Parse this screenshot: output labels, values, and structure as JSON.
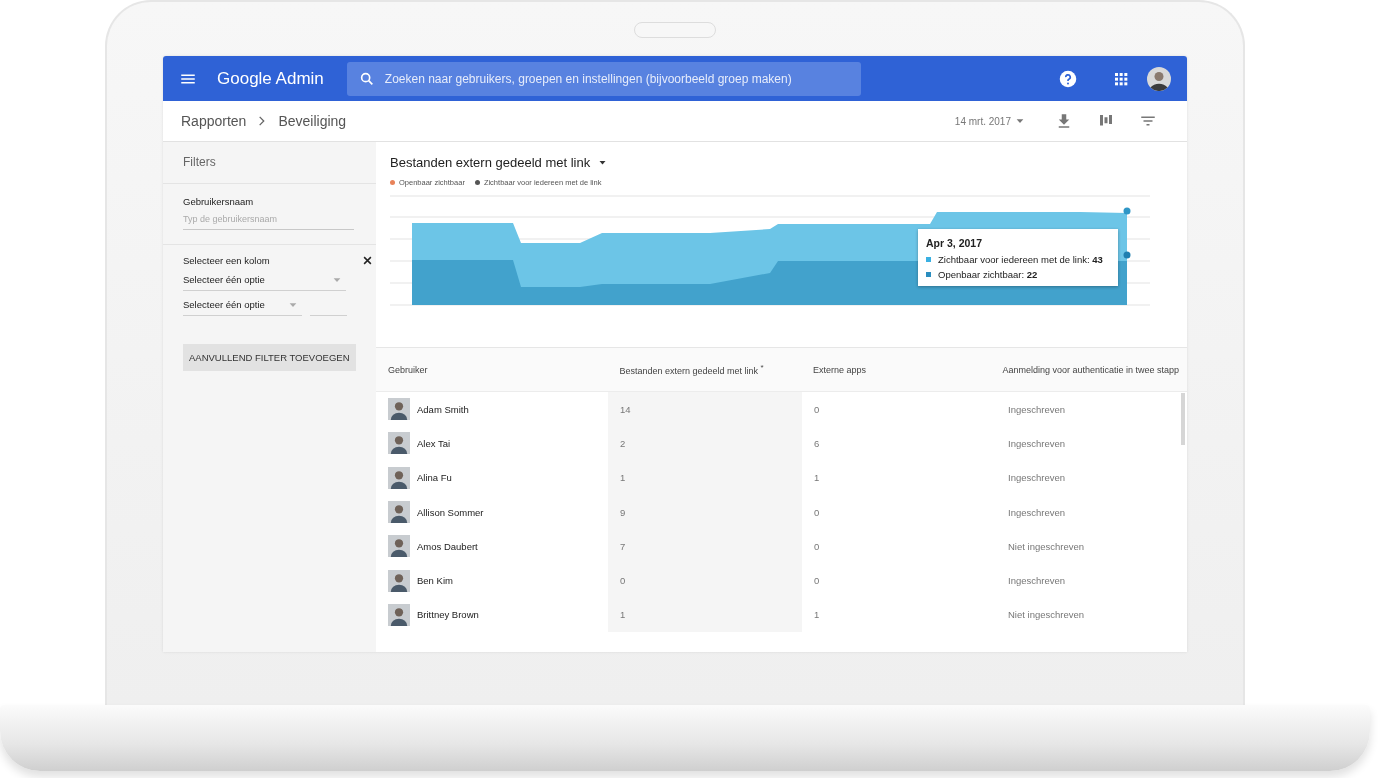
{
  "app": {
    "title": "Google Admin"
  },
  "search": {
    "placeholder": "Zoeken naar gebruikers, groepen en instellingen (bijvoorbeeld groep maken)"
  },
  "breadcrumb": [
    "Rapporten",
    "Beveiliging"
  ],
  "toolbar": {
    "date": "14 mrt. 2017"
  },
  "filters": {
    "title": "Filters",
    "username": {
      "label": "Gebruikersnaam",
      "placeholder": "Typ de gebruikersnaam"
    },
    "column_filter": {
      "label": "Selecteer een kolom",
      "selects": [
        "Selecteer één optie",
        "Selecteer één optie"
      ]
    },
    "add_button": "AANVULLEND FILTER TOEVOEGEN"
  },
  "chart": {
    "title": "Bestanden extern gedeeld met link",
    "legend": [
      {
        "label": "Openbaar zichtbaar",
        "color": "#e8835a"
      },
      {
        "label": "Zichtbaar voor iedereen met de link",
        "color": "#555555"
      }
    ],
    "tooltip": {
      "date": "Apr 3, 2017",
      "items": [
        {
          "text": "Zichtbaar voor iedereen met de link: **43**",
          "color": "#3ab0e2"
        },
        {
          "text": "Openbaar zichtbaar: **22**",
          "color": "#2a8dbf"
        }
      ]
    }
  },
  "table": {
    "columns": [
      "Gebruiker",
      "Bestanden extern gedeeld met link $^{*}$",
      "Externe apps",
      "Aanmelding voor authenticatie in twee stapp"
    ],
    "rows": [
      {
        "user": "Adam Smith",
        "files": "14",
        "apps": "0",
        "two_step": "Ingeschreven"
      },
      {
        "user": "Alex Tai",
        "files": "2",
        "apps": "6",
        "two_step": "Ingeschreven"
      },
      {
        "user": "Alina Fu",
        "files": "1",
        "apps": "1",
        "two_step": "Ingeschreven"
      },
      {
        "user": "Allison Sommer",
        "files": "9",
        "apps": "0",
        "two_step": "Ingeschreven"
      },
      {
        "user": "Amos Daubert",
        "files": "7",
        "apps": "0",
        "two_step": "Niet ingeschreven"
      },
      {
        "user": "Ben Kim",
        "files": "0",
        "apps": "0",
        "two_step": "Ingeschreven"
      },
      {
        "user": "Brittney Brown",
        "files": "1",
        "apps": "1",
        "two_step": "Niet ingeschreven"
      }
    ]
  }
}
